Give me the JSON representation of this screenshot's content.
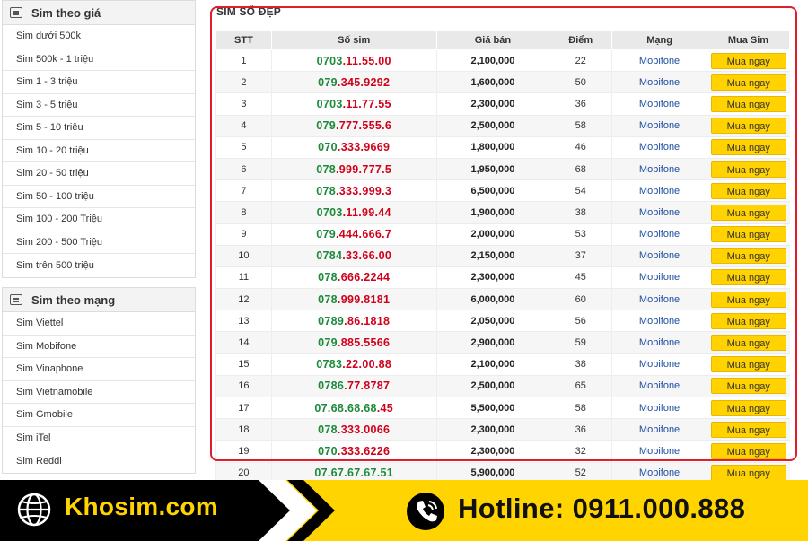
{
  "sidebar": {
    "price_section": {
      "title": "Sim theo giá",
      "items": [
        "Sim dưới 500k",
        "Sim 500k - 1 triệu",
        "Sim 1 - 3 triệu",
        "Sim 3 - 5 triệu",
        "Sim 5 - 10 triệu",
        "Sim 10 - 20 triệu",
        "Sim 20 - 50 triệu",
        "Sim 50 - 100 triệu",
        "Sim 100 - 200 Triệu",
        "Sim 200 - 500 Triệu",
        "Sim trên 500 triệu"
      ]
    },
    "network_section": {
      "title": "Sim theo mạng",
      "items": [
        "Sim Viettel",
        "Sim Mobifone",
        "Sim Vinaphone",
        "Sim Vietnamobile",
        "Sim Gmobile",
        "Sim iTel",
        "Sim Reddi"
      ]
    }
  },
  "main": {
    "title": "SIM SỐ ĐẸP",
    "columns": [
      "STT",
      "Số sim",
      "Giá bán",
      "Điểm",
      "Mạng",
      "Mua Sim"
    ],
    "buy_label": "Mua ngay",
    "rows": [
      {
        "stt": "1",
        "prefix": "0703",
        "suffix": ".11.55.00",
        "price": "2,100,000",
        "score": "22",
        "network": "Mobifone"
      },
      {
        "stt": "2",
        "prefix": "079",
        "suffix": ".345.9292",
        "price": "1,600,000",
        "score": "50",
        "network": "Mobifone"
      },
      {
        "stt": "3",
        "prefix": "0703",
        "suffix": ".11.77.55",
        "price": "2,300,000",
        "score": "36",
        "network": "Mobifone"
      },
      {
        "stt": "4",
        "prefix": "079",
        "suffix": ".777.555.6",
        "price": "2,500,000",
        "score": "58",
        "network": "Mobifone"
      },
      {
        "stt": "5",
        "prefix": "070",
        "suffix": ".333.9669",
        "price": "1,800,000",
        "score": "46",
        "network": "Mobifone"
      },
      {
        "stt": "6",
        "prefix": "078",
        "suffix": ".999.777.5",
        "price": "1,950,000",
        "score": "68",
        "network": "Mobifone"
      },
      {
        "stt": "7",
        "prefix": "078",
        "suffix": ".333.999.3",
        "price": "6,500,000",
        "score": "54",
        "network": "Mobifone"
      },
      {
        "stt": "8",
        "prefix": "0703",
        "suffix": ".11.99.44",
        "price": "1,900,000",
        "score": "38",
        "network": "Mobifone"
      },
      {
        "stt": "9",
        "prefix": "079",
        "suffix": ".444.666.7",
        "price": "2,000,000",
        "score": "53",
        "network": "Mobifone"
      },
      {
        "stt": "10",
        "prefix": "0784",
        "suffix": ".33.66.00",
        "price": "2,150,000",
        "score": "37",
        "network": "Mobifone"
      },
      {
        "stt": "11",
        "prefix": "078",
        "suffix": ".666.2244",
        "price": "2,300,000",
        "score": "45",
        "network": "Mobifone"
      },
      {
        "stt": "12",
        "prefix": "078",
        "suffix": ".999.8181",
        "price": "6,000,000",
        "score": "60",
        "network": "Mobifone"
      },
      {
        "stt": "13",
        "prefix": "0789",
        "suffix": ".86.1818",
        "price": "2,050,000",
        "score": "56",
        "network": "Mobifone"
      },
      {
        "stt": "14",
        "prefix": "079",
        "suffix": ".885.5566",
        "price": "2,900,000",
        "score": "59",
        "network": "Mobifone"
      },
      {
        "stt": "15",
        "prefix": "0783",
        "suffix": ".22.00.88",
        "price": "2,100,000",
        "score": "38",
        "network": "Mobifone"
      },
      {
        "stt": "16",
        "prefix": "0786",
        "suffix": ".77.8787",
        "price": "2,500,000",
        "score": "65",
        "network": "Mobifone"
      },
      {
        "stt": "17",
        "prefix": "07.68.68.68",
        "suffix": ".45",
        "price": "5,500,000",
        "score": "58",
        "network": "Mobifone"
      },
      {
        "stt": "18",
        "prefix": "078",
        "suffix": ".333.0066",
        "price": "2,300,000",
        "score": "36",
        "network": "Mobifone"
      },
      {
        "stt": "19",
        "prefix": "070",
        "suffix": ".333.6226",
        "price": "2,300,000",
        "score": "32",
        "network": "Mobifone"
      },
      {
        "stt": "20",
        "prefix": "07.67.67.67.51",
        "suffix": "",
        "price": "5,900,000",
        "score": "52",
        "network": "Mobifone"
      }
    ]
  },
  "banner": {
    "brand": "Khosim.com",
    "hotline": "Hotline: 0911.000.888"
  },
  "colors": {
    "highlight_border": "#e01d2c",
    "sim_green": "#1d8a3a",
    "sim_red": "#d0021b",
    "network_blue": "#1f4fa0",
    "buy_button": "#ffd200",
    "banner_yellow": "#ffd400"
  },
  "icons": [
    "list-icon",
    "globe-icon",
    "phone-icon"
  ]
}
